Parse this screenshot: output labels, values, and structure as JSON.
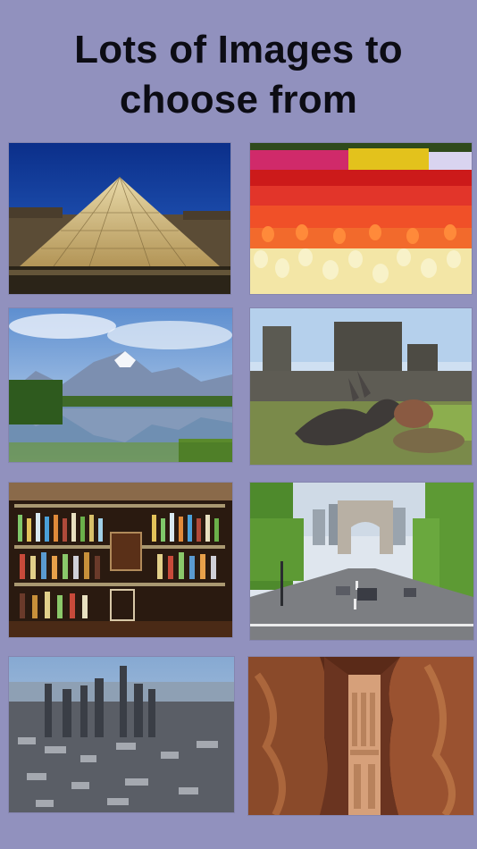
{
  "headline": {
    "line1": "Lots of Images to",
    "line2": "choose from"
  },
  "colors": {
    "background": "#9191be",
    "headline_text": "#0c0c14"
  },
  "gallery": {
    "images": [
      {
        "id": "louvre-pyramid-photo"
      },
      {
        "id": "tulip-field-photo"
      },
      {
        "id": "mountain-lake-reflection-photo"
      },
      {
        "id": "castle-dragon-sculpture-photo"
      },
      {
        "id": "bar-shelves-photo"
      },
      {
        "id": "arc-de-triomphe-avenue-photo"
      },
      {
        "id": "manhattan-skyline-photo"
      },
      {
        "id": "petra-siq-treasury-photo"
      }
    ]
  }
}
